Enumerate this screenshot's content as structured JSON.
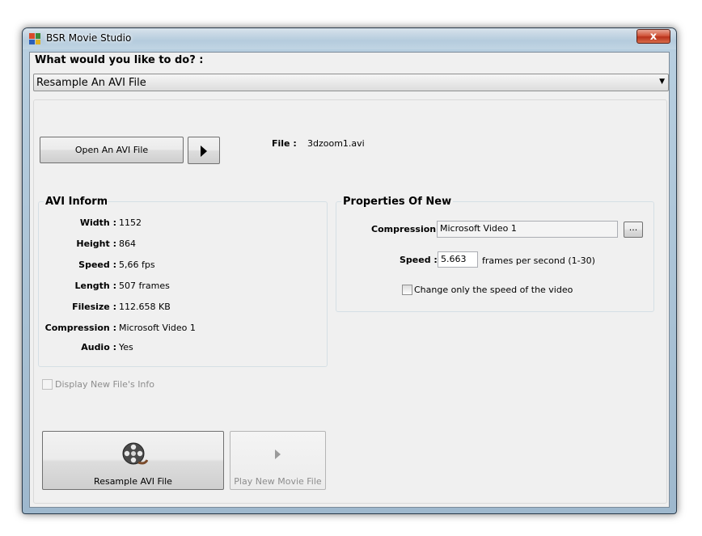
{
  "window": {
    "title": "BSR Movie Studio",
    "close_glyph": "x"
  },
  "question": "What would you like to do? :",
  "action_select": {
    "selected": "Resample An AVI File"
  },
  "toolbar": {
    "open_label": "Open An AVI File",
    "file_label": "File :",
    "file_value": "3dzoom1.avi"
  },
  "avi_info": {
    "title": "AVI Informa",
    "rows": [
      {
        "label": "Width :",
        "value": "1152"
      },
      {
        "label": "Height :",
        "value": "864"
      },
      {
        "label": "Speed :",
        "value": "5,66 fps"
      },
      {
        "label": "Length :",
        "value": "507 frames"
      },
      {
        "label": "Filesize :",
        "value": "112.658 KB"
      },
      {
        "label": "Compression :",
        "value": "Microsoft Video 1"
      },
      {
        "label": "Audio :",
        "value": "Yes"
      }
    ]
  },
  "properties": {
    "title": "Properties Of New",
    "compression_label": "Compression :",
    "compression_value": "Microsoft Video 1",
    "browse_label": "...",
    "speed_label": "Speed :",
    "speed_value": "5.663",
    "speed_unit": "frames per second (1-30)",
    "change_speed_only_label": "Change only the speed of the video",
    "change_speed_only_checked": false
  },
  "display_new_info": {
    "label": "Display New File's Info",
    "checked": false,
    "enabled": false
  },
  "actions": {
    "resample_label": "Resample AVI File",
    "play_new_label": "Play New Movie File"
  }
}
